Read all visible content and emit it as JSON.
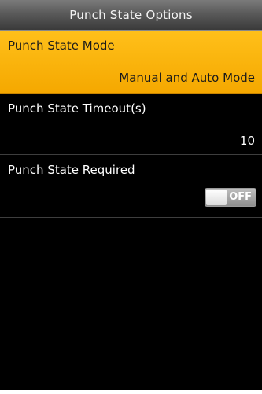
{
  "header": {
    "title": "Punch State Options"
  },
  "options": [
    {
      "label": "Punch State Mode",
      "value": "Manual and Auto Mode",
      "selected": true
    },
    {
      "label": "Punch State Timeout(s)",
      "value": "10",
      "selected": false
    },
    {
      "label": "Punch State Required",
      "toggle_text": "OFF",
      "toggle_state": "off",
      "selected": false
    }
  ],
  "colors": {
    "selected_background": "#F5A800",
    "screen_background": "#000000",
    "header_background": "#5A5A5A"
  }
}
